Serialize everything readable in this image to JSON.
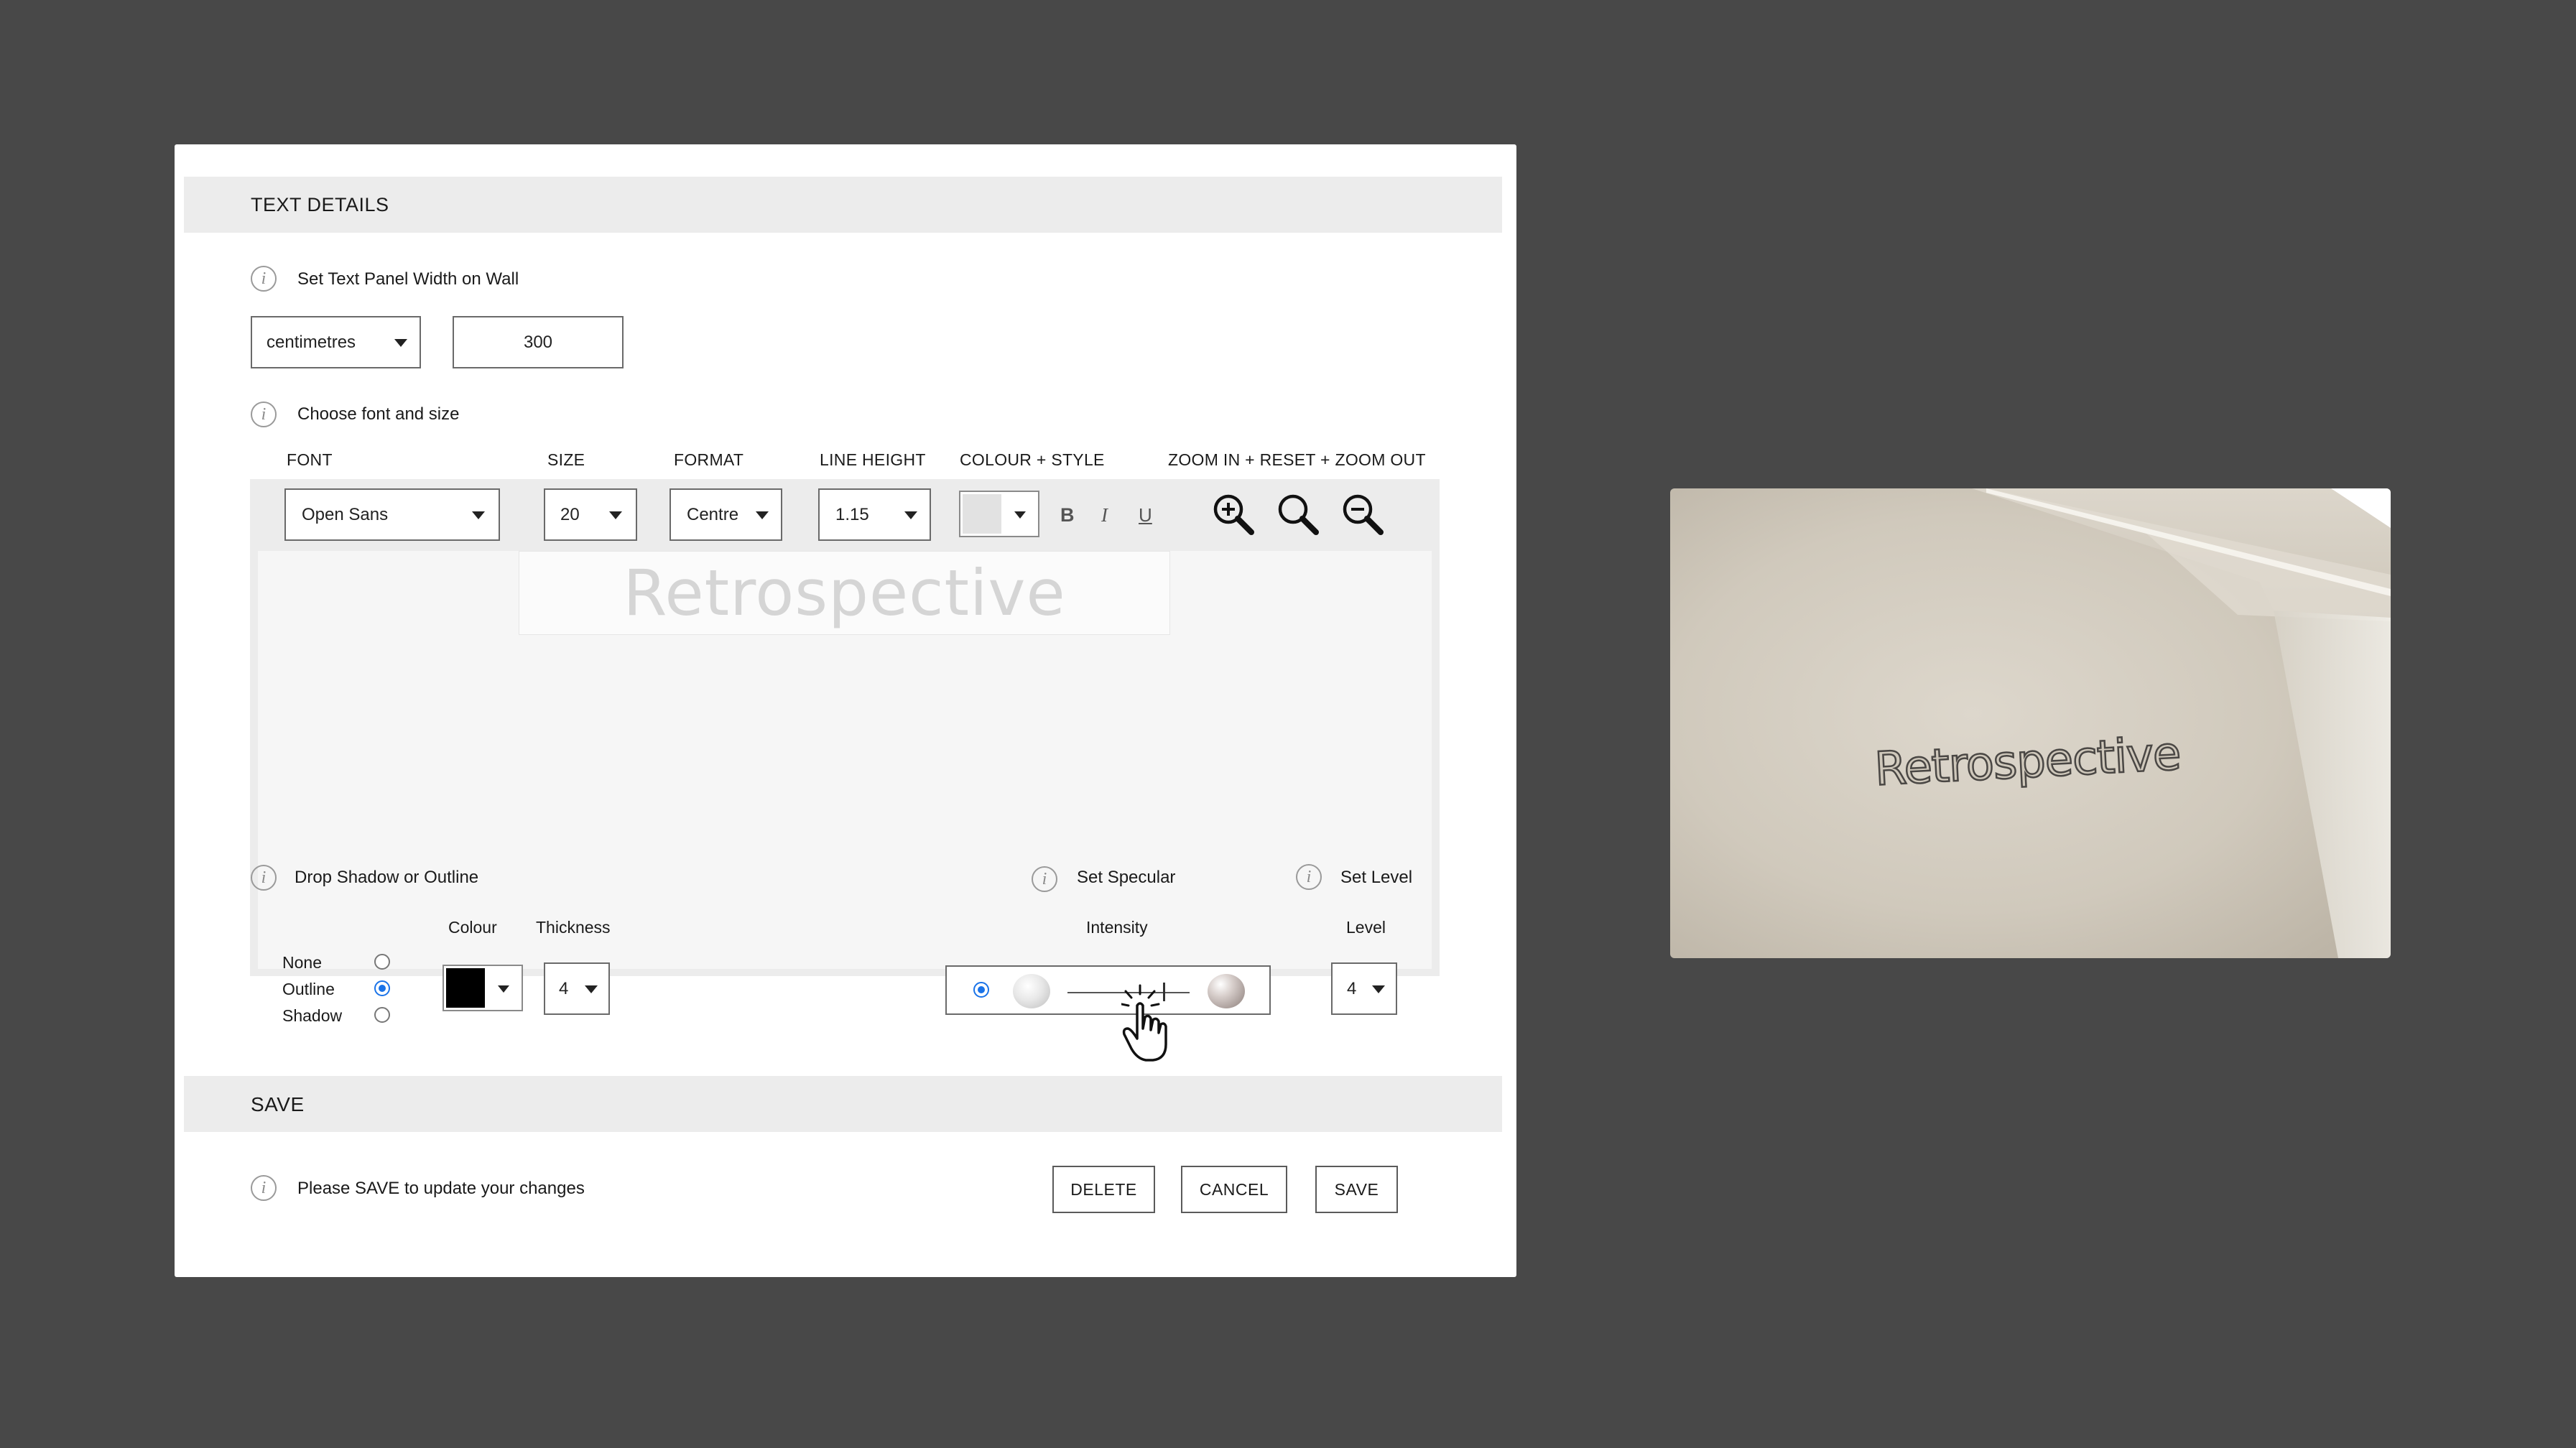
{
  "text_details": {
    "section_title": "TEXT DETAILS",
    "panel_width": {
      "label": "Set Text Panel Width on Wall",
      "unit": "centimetres",
      "value": "300"
    },
    "font_section": {
      "label": "Choose font and size",
      "headers": {
        "font": "FONT",
        "size": "SIZE",
        "format": "FORMAT",
        "line_height": "LINE HEIGHT",
        "colour_style": "COLOUR + STYLE",
        "zoom": "ZOOM IN + RESET + ZOOM OUT"
      },
      "font": "Open Sans",
      "size": "20",
      "format": "Centre",
      "line_height": "1.15",
      "bold": "B",
      "italic": "I",
      "underline": "U",
      "preview_text": "Retrospective"
    },
    "drop_shadow": {
      "label": "Drop Shadow or Outline",
      "options": [
        "None",
        "Outline",
        "Shadow"
      ],
      "selected": "Outline",
      "colour_header": "Colour",
      "thickness_header": "Thickness",
      "colour": "#000000",
      "thickness": "4"
    },
    "specular": {
      "label": "Set Specular",
      "intensity_header": "Intensity",
      "intensity_fraction": 0.78
    },
    "level": {
      "label": "Set Level",
      "level_header": "Level",
      "value": "4"
    }
  },
  "save": {
    "section_title": "SAVE",
    "hint": "Please SAVE to update your changes",
    "delete_label": "DELETE",
    "cancel_label": "CANCEL",
    "save_label": "SAVE"
  },
  "wall_preview": {
    "text": "Retrospective",
    "wall_color": "#d9d3c7"
  }
}
